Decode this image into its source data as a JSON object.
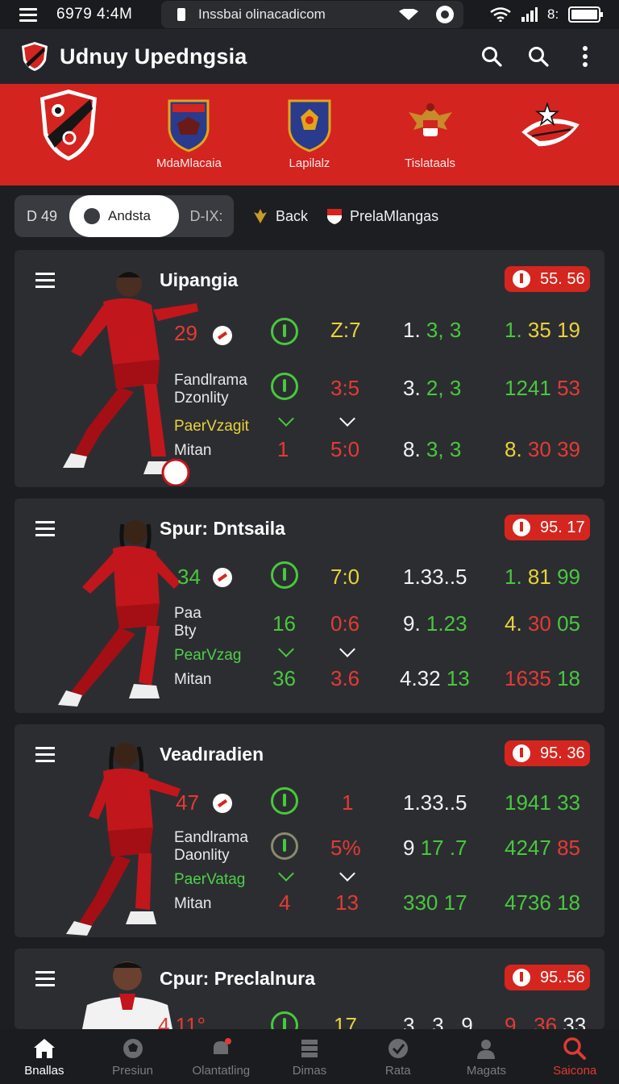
{
  "statusbar": {
    "time": "6979 4:4M",
    "url": "Inssbai olinacadicom",
    "right_text": "8:"
  },
  "appbar": {
    "title": "Udnuy Upedngsia"
  },
  "clubs": [
    {
      "name": ""
    },
    {
      "name": "MdaMlacaia"
    },
    {
      "name": "Lapilalz"
    },
    {
      "name": "Tislataals"
    },
    {
      "name": ""
    }
  ],
  "filters": {
    "segment_left": "D 49",
    "segment_active": "Andsta",
    "segment_right": "D-IX:",
    "back_label": "Back",
    "league_label": "PrelaMlangas"
  },
  "cards": [
    {
      "title": "Uipangia",
      "badge": "55. 56",
      "row1": {
        "num": "29",
        "mid": "Z:7",
        "c3a": "1. ",
        "c3b": "3, 3",
        "c4a": "1. ",
        "c4b": "35",
        "c4c": "19"
      },
      "labels": [
        "Fandlrama",
        "Dzonlity",
        "PaerVzagit",
        "Mitan"
      ],
      "row2": {
        "mid": "3:5",
        "c3a": "3. ",
        "c3b": "2, 3",
        "c4a": "1241",
        "c4b": "53"
      },
      "row3": {
        "left": "1",
        "mid": "5:0",
        "c3a": "8. ",
        "c3b": "3, 3",
        "c4a": "8. ",
        "c4b": "30",
        "c4c": "39"
      }
    },
    {
      "title": "Spur: Dntsaila",
      "badge": "95. 17",
      "row1": {
        "num": "34",
        "mid": "7:0",
        "c3a": "1.33..5",
        "c4a": "1. ",
        "c4b": "81",
        "c4c": "99"
      },
      "labels": [
        "Paa",
        "Bty",
        "PearVzag",
        "Mitan"
      ],
      "row2": {
        "left": "16",
        "mid": "0:6",
        "c3a": "9. ",
        "c3b": "1.23",
        "c4a": "4. ",
        "c4b": "30",
        "c4c": "05"
      },
      "row3": {
        "left": "36",
        "mid": "3.6",
        "c3a": "4.32",
        "c3b": "13",
        "c4a": "1635",
        "c4b": "18"
      }
    },
    {
      "title": "Veadıradien",
      "badge": "95. 36",
      "row1": {
        "num": "47",
        "mid": "1",
        "c3a": "1.33..5",
        "c4a": "1941",
        "c4b": "33"
      },
      "labels": [
        "Eandlrama",
        "Daonlity",
        "PaerVatag",
        "Mitan"
      ],
      "row2": {
        "mid": "5%",
        "c3a": "9 ",
        "c3b": "17 .7",
        "c4a": "4247",
        "c4b": "85"
      },
      "row3": {
        "left": "4",
        "mid": "13",
        "c3a": "330 17",
        "c4a": "4736",
        "c4b": "18"
      }
    },
    {
      "title": "Cpur: Preclalnura",
      "badge": "95..56",
      "row1": {
        "num": "4 11°",
        "mid": "17",
        "c3a": "3 . 3 . 9",
        "c4a": "9 . 36",
        "c4b": "33"
      }
    }
  ],
  "bottomnav": [
    {
      "label": "Bnallas"
    },
    {
      "label": "Presiun"
    },
    {
      "label": "Olantatling"
    },
    {
      "label": "Dimas"
    },
    {
      "label": "Rata"
    },
    {
      "label": "Magats"
    },
    {
      "label": "Saicona"
    }
  ]
}
